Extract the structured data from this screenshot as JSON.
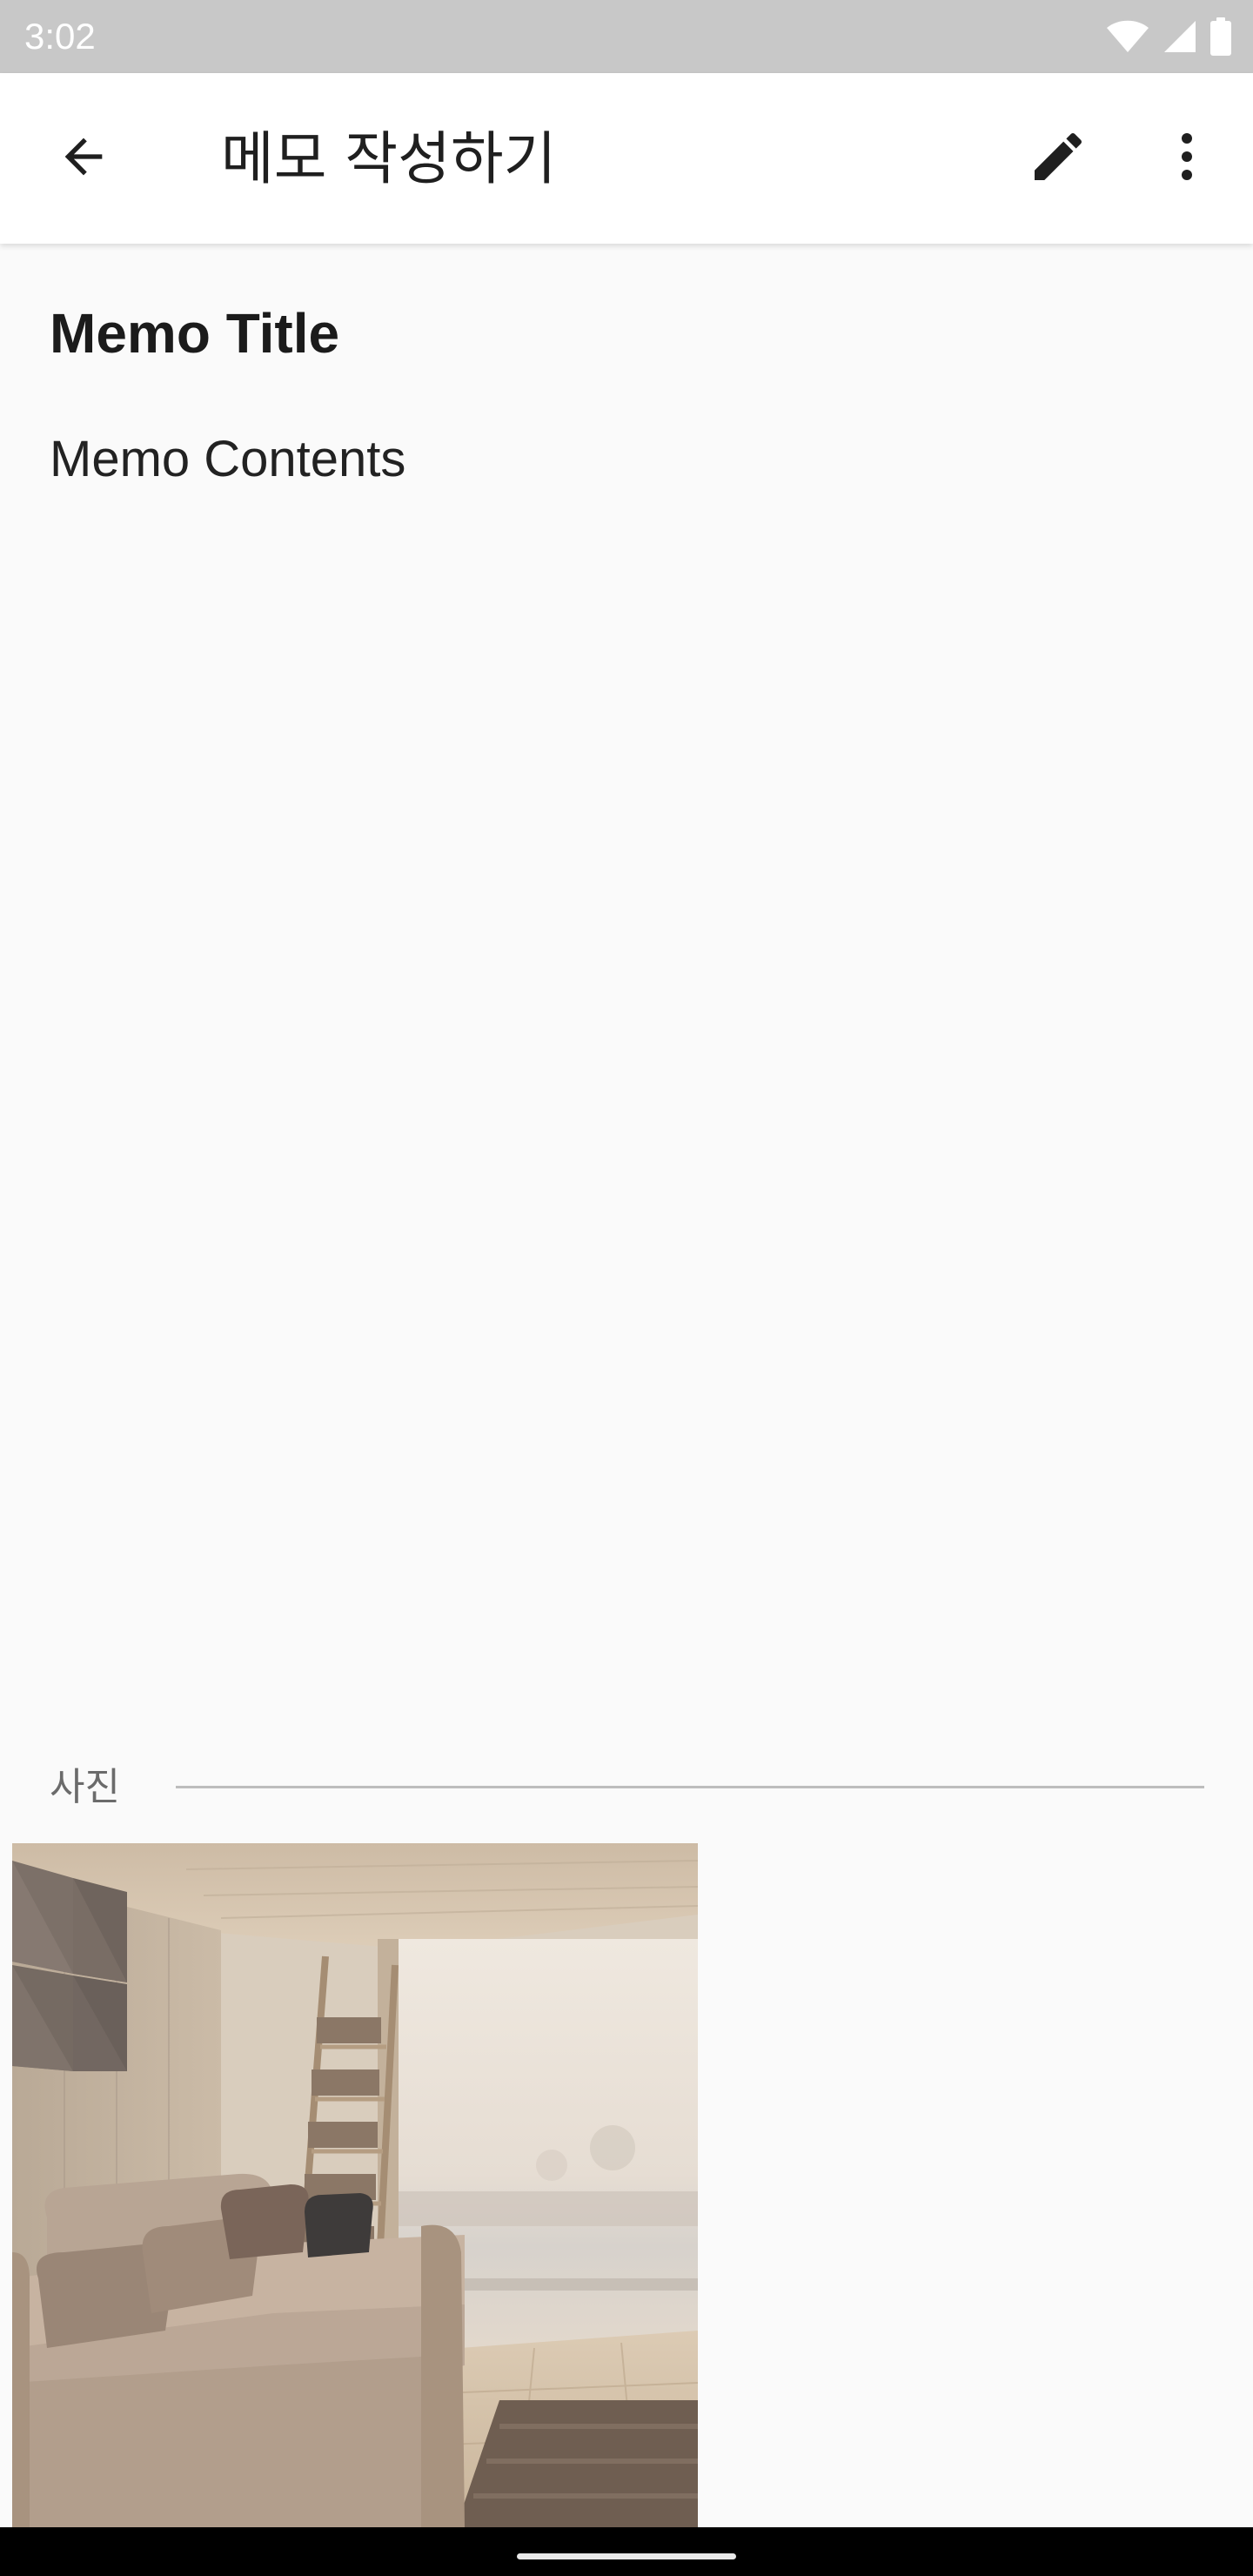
{
  "status_bar": {
    "time": "3:02",
    "icons": [
      "wifi-icon",
      "cellular-signal-icon",
      "battery-icon"
    ]
  },
  "app_bar": {
    "title": "메모 작성하기",
    "back_icon": "arrow-back-icon",
    "edit_icon": "pencil-icon",
    "more_icon": "more-vert-icon"
  },
  "memo": {
    "title": "Memo Title",
    "contents": "Memo Contents"
  },
  "photos": {
    "section_label": "사진",
    "items": [
      {
        "subject": "living room with beige sofa, wall panels, ladder bookshelf and large window"
      }
    ]
  },
  "colors": {
    "status_bar_bg": "#c8c8c8",
    "app_bar_bg": "#ffffff",
    "page_bg": "#fafafa",
    "nav_bar_bg": "#000000"
  }
}
